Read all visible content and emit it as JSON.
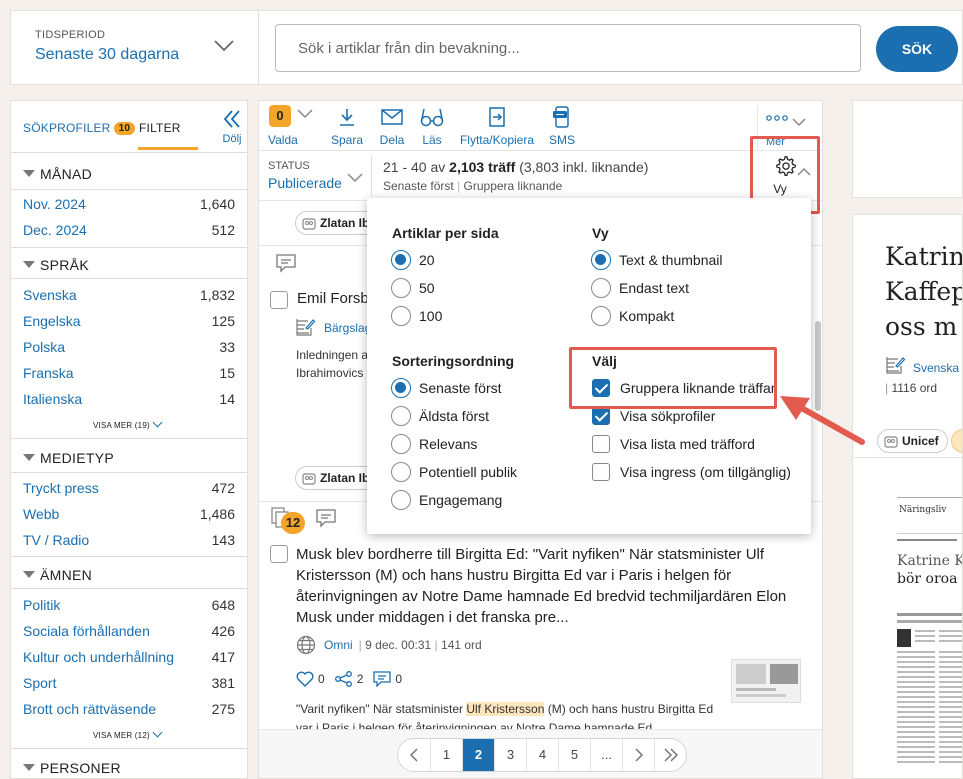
{
  "period": {
    "label": "TIDSPERIOD",
    "value": "Senaste 30 dagarna"
  },
  "search": {
    "placeholder": "Sök i artiklar från din bevakning...",
    "button": "SÖK"
  },
  "sidebar": {
    "tab_profiles": "SÖKPROFILER",
    "tab_profiles_count": "10",
    "tab_filter": "FILTER",
    "hide": "Dölj",
    "sections": [
      {
        "title": "MÅNAD",
        "items": [
          {
            "label": "Nov. 2024",
            "count": "1,640"
          },
          {
            "label": "Dec. 2024",
            "count": "512"
          }
        ]
      },
      {
        "title": "SPRÅK",
        "items": [
          {
            "label": "Svenska",
            "count": "1,832"
          },
          {
            "label": "Engelska",
            "count": "125"
          },
          {
            "label": "Polska",
            "count": "33"
          },
          {
            "label": "Franska",
            "count": "15"
          },
          {
            "label": "Italienska",
            "count": "14"
          }
        ],
        "more": "VISA MER (19)"
      },
      {
        "title": "MEDIETYP",
        "items": [
          {
            "label": "Tryckt press",
            "count": "472"
          },
          {
            "label": "Webb",
            "count": "1,486"
          },
          {
            "label": "TV / Radio",
            "count": "143"
          }
        ]
      },
      {
        "title": "ÄMNEN",
        "items": [
          {
            "label": "Politik",
            "count": "648"
          },
          {
            "label": "Sociala förhållanden",
            "count": "426"
          },
          {
            "label": "Kultur och underhållning",
            "count": "417"
          },
          {
            "label": "Sport",
            "count": "381"
          },
          {
            "label": "Brott och rättväsende",
            "count": "275"
          }
        ],
        "more": "VISA MER (12)"
      },
      {
        "title": "PERSONER"
      }
    ]
  },
  "toolbar": {
    "selected_count": "0",
    "selected": "Valda",
    "save": "Spara",
    "share": "Dela",
    "read": "Läs",
    "move": "Flytta/Kopiera",
    "sms": "SMS",
    "more": "Mer",
    "view": "Vy"
  },
  "status": {
    "label": "STATUS",
    "value": "Publicerade",
    "range": "21 - 40 av",
    "total": "2,103 träff",
    "incl": "(3,803 inkl. liknande)",
    "sort": "Senaste först",
    "group": "Gruppera liknande"
  },
  "article1": {
    "tag": "Zlatan Ib",
    "title": "Emil Forsbe",
    "source": "Bärgslag",
    "text1": "Inledningen a",
    "text2": "Ibrahimovics",
    "tag2": "Zlatan Ib"
  },
  "article2": {
    "count_badge": "12",
    "title": "Musk blev bordherre till Birgitta Ed: \"Varit nyfiken\" När statsminister Ulf Kristersson (M) och hans hustru Birgitta Ed var i Paris i helgen för återinvigningen av Notre Dame hamnade Ed bredvid techmiljardären Elon Musk under middagen i det franska pre...",
    "source": "Omni",
    "date": "9 dec. 00:31",
    "words": "141 ord",
    "likes": "0",
    "shares": "2",
    "comments": "0",
    "snippet_pre": "\"Varit nyfiken\" När statsminister ",
    "snippet_hl": "Ulf Kristersson",
    "snippet_post": " (M) och hans hustru Birgitta Ed var i Paris i helgen för återinvigningen av Notre Dame hamnade Ed"
  },
  "pagination": {
    "pages": [
      "1",
      "2",
      "3",
      "4",
      "5",
      "..."
    ],
    "current": "2"
  },
  "dropdown": {
    "per_page_title": "Artiklar per sida",
    "per_page": [
      "20",
      "50",
      "100"
    ],
    "per_page_selected": "20",
    "view_title": "Vy",
    "view_options": [
      "Text & thumbnail",
      "Endast text",
      "Kompakt"
    ],
    "view_selected": "Text & thumbnail",
    "sort_title": "Sorteringsordning",
    "sort_options": [
      "Senaste först",
      "Äldsta först",
      "Relevans",
      "Potentiell publik",
      "Engagemang"
    ],
    "sort_selected": "Senaste först",
    "choose_title": "Välj",
    "choose_options": [
      {
        "label": "Gruppera liknande träffar",
        "checked": true
      },
      {
        "label": "Visa sökprofiler",
        "checked": true
      },
      {
        "label": "Visa lista med träfford",
        "checked": false
      },
      {
        "label": "Visa ingress (om tillgänglig)",
        "checked": false
      }
    ]
  },
  "right": {
    "title": "Katrin\nKaffep\noss m",
    "source": "Svenska",
    "words": "1116 ord",
    "tag": "Unicef",
    "paper_section": "Näringsliv",
    "paper_headline": "Katrine K",
    "paper_sub": "bör oroa o"
  },
  "colors": {
    "accent": "#1b6fb0",
    "badge": "#f3a52a",
    "annotation": "#e35a4f",
    "background": "#f5f0ec"
  }
}
